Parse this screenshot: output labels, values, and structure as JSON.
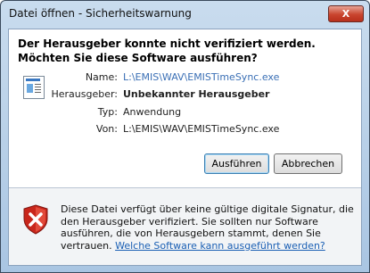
{
  "window": {
    "title": "Datei öffnen - Sicherheitswarnung",
    "close_label": "X"
  },
  "headline": "Der Herausgeber konnte nicht verifiziert werden. Möchten Sie diese Software ausführen?",
  "details": {
    "name_label": "Name:",
    "name_value": "L:\\EMIS\\WAV\\EMISTimeSync.exe",
    "publisher_label": "Herausgeber:",
    "publisher_value": "Unbekannter Herausgeber",
    "type_label": "Typ:",
    "type_value": "Anwendung",
    "from_label": "Von:",
    "from_value": "L:\\EMIS\\WAV\\EMISTimeSync.exe"
  },
  "buttons": {
    "run": "Ausführen",
    "cancel": "Abbrechen"
  },
  "warning": {
    "text": "Diese Datei verfügt über keine gültige digitale Signatur, die den Herausgeber verifiziert. Sie sollten nur Software ausführen, die von Herausgebern stammt, denen Sie vertrauen. ",
    "link": "Welche Software kann ausgeführt werden?"
  },
  "icons": {
    "file": "executable-file-icon",
    "warning": "security-shield-error-icon"
  },
  "colors": {
    "link": "#3a6fb5",
    "shield_red": "#c8261b"
  }
}
